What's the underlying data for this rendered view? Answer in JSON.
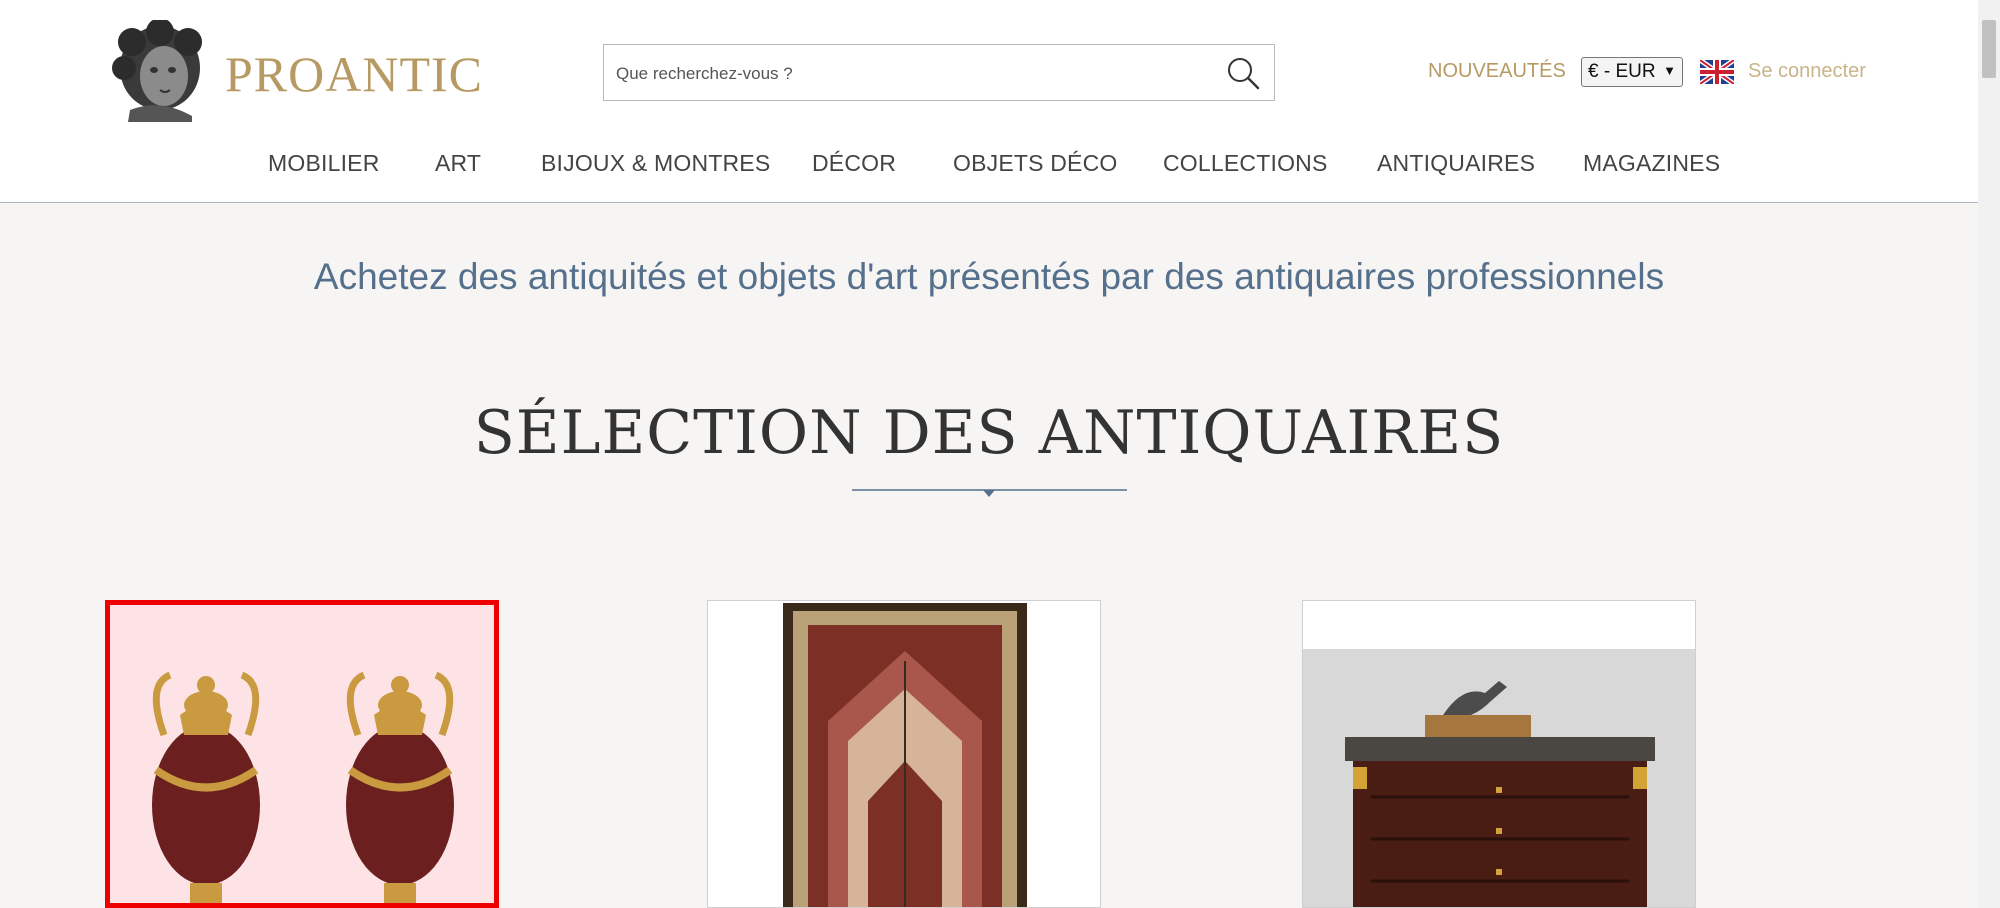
{
  "brand": {
    "name": "PROANTIC"
  },
  "search": {
    "placeholder": "Que recherchez-vous ?"
  },
  "header_links": {
    "new": "NOUVEAUTÉS",
    "currency": "€ - EUR",
    "login": "Se connecter"
  },
  "nav": [
    "MOBILIER",
    "ART",
    "BIJOUX & MONTRES",
    "DÉCOR",
    "OBJETS DÉCO",
    "COLLECTIONS",
    "ANTIQUAIRES",
    "MAGAZINES"
  ],
  "tagline": "Achetez des antiquités et objets d'art présentés par des antiquaires professionnels",
  "section_title": "SÉLECTION DES ANTIQUAIRES",
  "colors": {
    "gold": "#b79a63",
    "blue_text": "#55708c",
    "selection": "#ee0000"
  },
  "icons": {
    "search": "search-icon",
    "flag": "uk-flag-icon",
    "logo": "bust-logo-icon"
  }
}
